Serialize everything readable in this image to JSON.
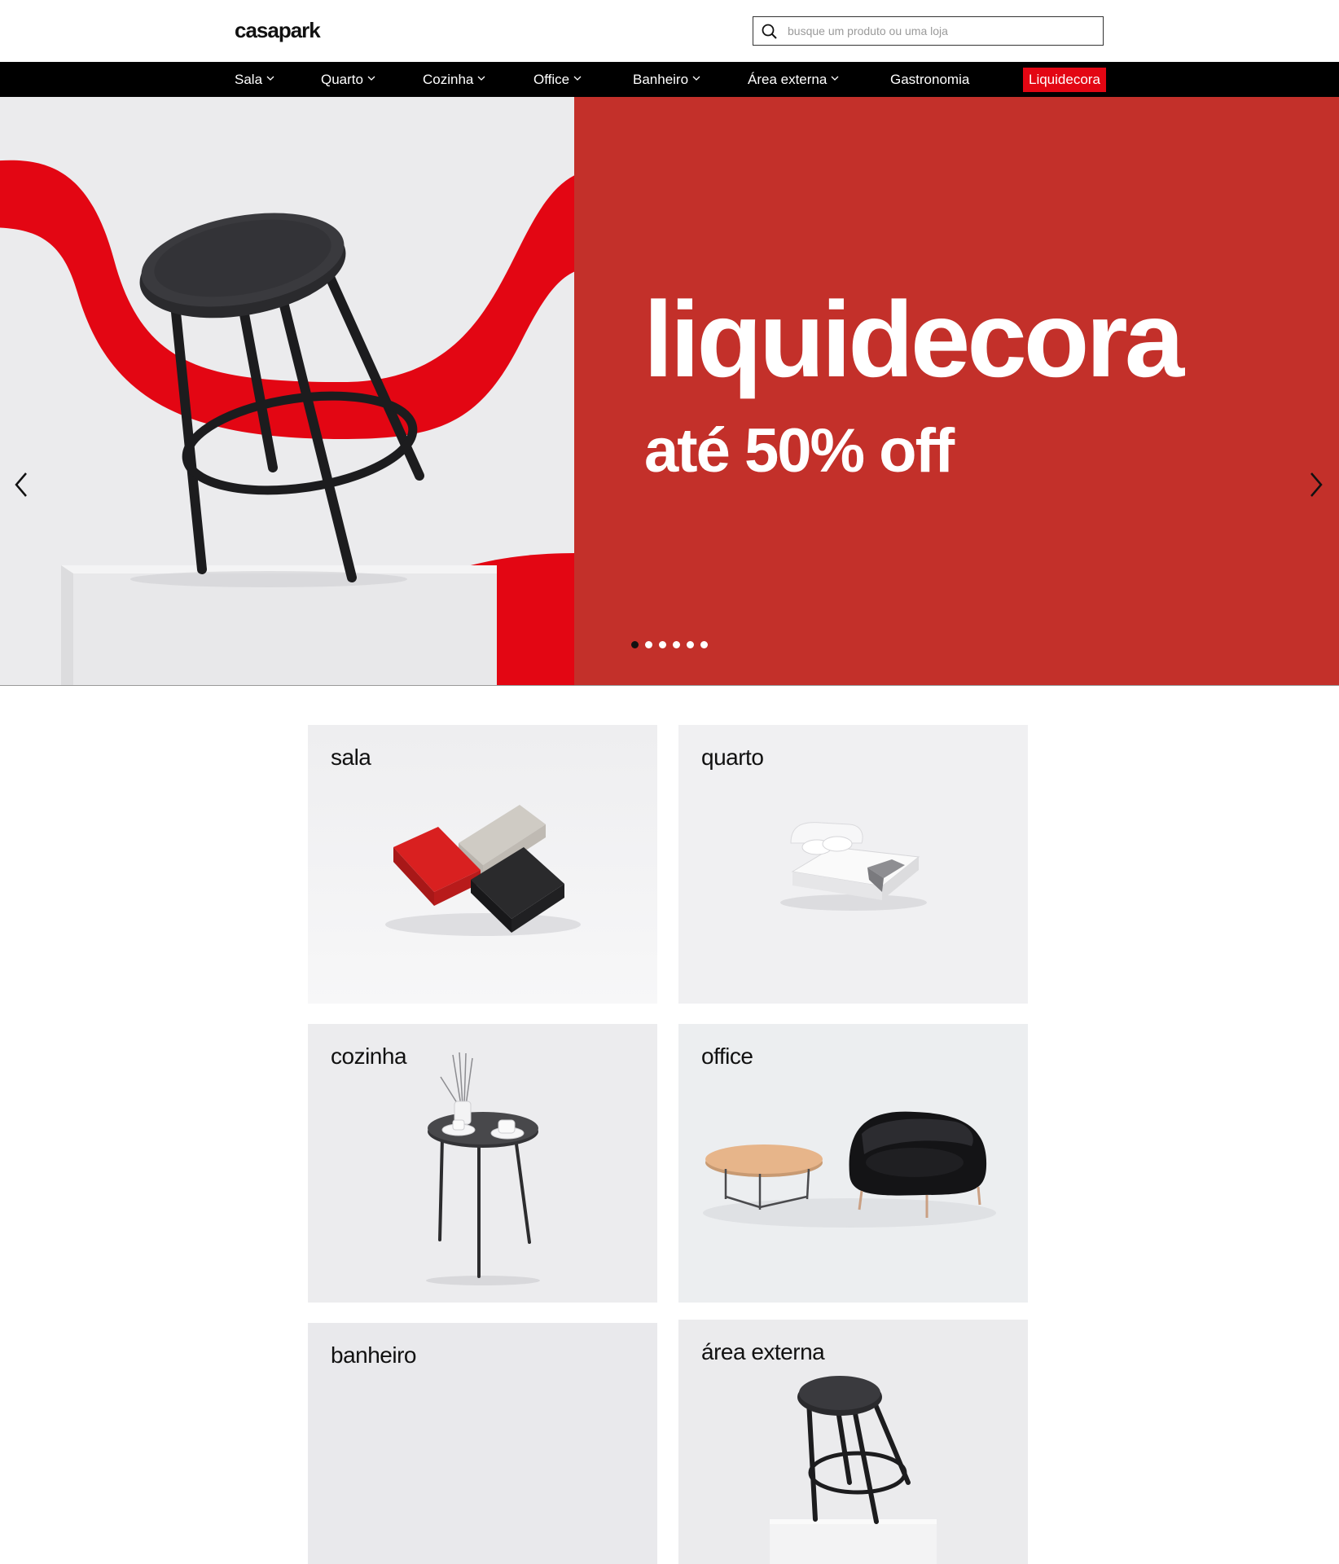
{
  "header": {
    "logo": "casapark",
    "search_placeholder": "busque um produto ou uma loja"
  },
  "nav": {
    "items": [
      {
        "label": "Sala",
        "dropdown": true
      },
      {
        "label": "Quarto",
        "dropdown": true
      },
      {
        "label": "Cozinha",
        "dropdown": true
      },
      {
        "label": "Office",
        "dropdown": true
      },
      {
        "label": "Banheiro",
        "dropdown": true
      },
      {
        "label": "Área externa",
        "dropdown": true
      },
      {
        "label": "Gastronomia",
        "dropdown": false
      }
    ],
    "sale_label": "Liquidecora",
    "sale_color": "#e30613"
  },
  "hero": {
    "title": "liquidecora",
    "subtitle": "até 50% off",
    "background_color": "#c3302a",
    "slide_count": 6,
    "active_slide": 1,
    "prev_icon": "chevron-left-icon",
    "next_icon": "chevron-right-icon"
  },
  "categories": [
    {
      "label": "sala",
      "image": "sofa-set"
    },
    {
      "label": "quarto",
      "image": "bed"
    },
    {
      "label": "cozinha",
      "image": "side-table"
    },
    {
      "label": "office",
      "image": "armchair-and-table"
    },
    {
      "label": "banheiro",
      "image": "empty"
    },
    {
      "label": "área externa",
      "image": "stool"
    }
  ]
}
